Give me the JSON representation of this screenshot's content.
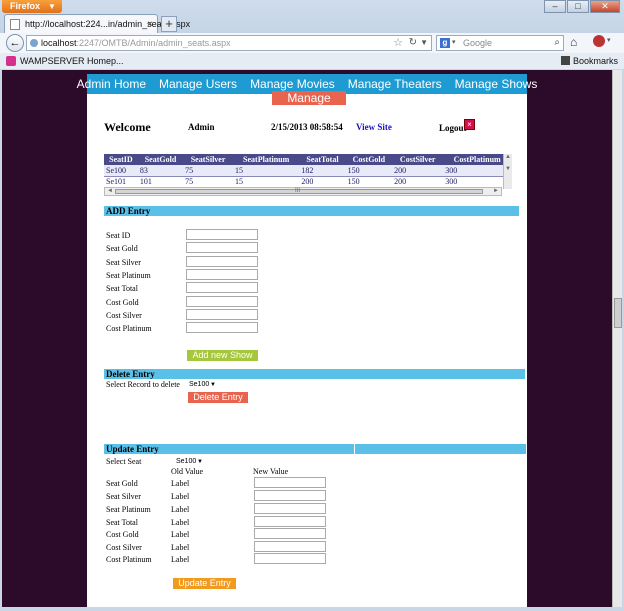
{
  "browser": {
    "app_button": "Firefox",
    "tab_title": "http://localhost:224...in/admin_seats.aspx",
    "url_host": "localhost",
    "url_rest": ":2247/OMTB/Admin/admin_seats.aspx",
    "search_placeholder": "Google",
    "bookmark": "WAMPSERVER Homep...",
    "bookmarks_label": "Bookmarks"
  },
  "menu": {
    "items": [
      "Admin Home",
      "Manage Users",
      "Manage Movies",
      "Manage Theaters",
      "Manage Shows"
    ],
    "active": "Manage Seats"
  },
  "header": {
    "welcome": "Welcome",
    "user": "Admin",
    "datetime": "2/15/2013 08:58:54",
    "view_site": "View Site",
    "logout": "Logout"
  },
  "grid": {
    "columns": [
      "SeatID",
      "SeatGold",
      "SeatSilver",
      "SeatPlatinum",
      "SeatTotal",
      "CostGold",
      "CostSilver",
      "CostPlatinum"
    ],
    "rows": [
      [
        "Se100",
        "83",
        "75",
        "15",
        "182",
        "150",
        "200",
        "300"
      ],
      [
        "Se101",
        "101",
        "75",
        "15",
        "200",
        "150",
        "200",
        "300"
      ]
    ],
    "hscroll_grip": "III"
  },
  "add": {
    "title": "ADD Entry",
    "fields": [
      "Seat ID",
      "Seat Gold",
      "Seat Silver",
      "Seat Platinum",
      "Seat Total",
      "Cost Gold",
      "Cost Silver",
      "Cost Platinum"
    ],
    "button": "Add new Show"
  },
  "delete": {
    "title": "Delete Entry",
    "label": "Select Record to delete",
    "selected": "Se100",
    "button": "Delete Entry"
  },
  "update": {
    "title": "Update Entry",
    "select_label": "Select Seat",
    "selected": "Se100",
    "old_header": "Old Value",
    "new_header": "New Value",
    "fields": [
      "Seat Gold",
      "Seat Silver",
      "Seat Platinum",
      "Seat Total",
      "Cost Gold",
      "Cost Silver",
      "Cost Platinum"
    ],
    "old_value": "Label",
    "button": "Update Entry"
  }
}
